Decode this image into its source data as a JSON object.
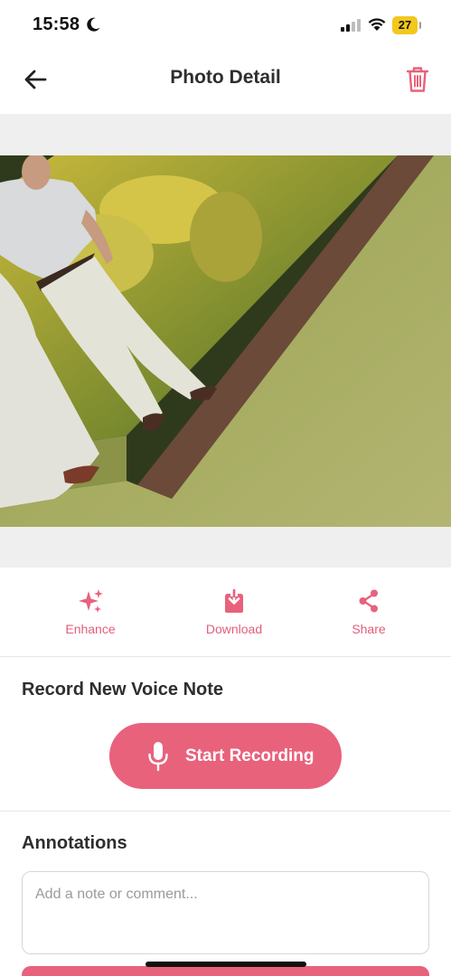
{
  "status_bar": {
    "time": "15:58",
    "battery_level": "27",
    "battery_color": "#f2c81c"
  },
  "header": {
    "title": "Photo Detail",
    "back_icon": "arrow-left-icon",
    "delete_icon": "trash-icon"
  },
  "photo": {
    "description_icon": "photo"
  },
  "actions": [
    {
      "label": "Enhance",
      "icon": "sparkles-icon"
    },
    {
      "label": "Download",
      "icon": "download-icon"
    },
    {
      "label": "Share",
      "icon": "share-icon"
    }
  ],
  "voice_note": {
    "title": "Record New Voice Note",
    "button_label": "Start Recording",
    "button_icon": "microphone-icon"
  },
  "annotations": {
    "title": "Annotations",
    "placeholder": "Add a note or comment..."
  },
  "theme": {
    "accent": "#e8627c",
    "accent_text": "#e35d7a"
  }
}
